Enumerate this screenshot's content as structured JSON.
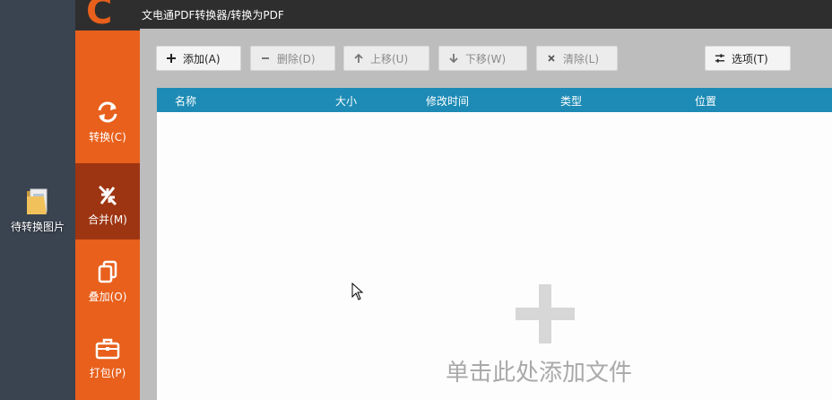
{
  "desktop": {
    "icon": "folder-icon",
    "icon_label": "待转换图片"
  },
  "app": {
    "title": "文电通PDF转换器/转换为PDF",
    "logo_text": "C",
    "brand_color": "#e8601c",
    "accent_color": "#1d8bb5"
  },
  "sidebar": {
    "items": [
      {
        "label": "转换(C)",
        "icon": "refresh-icon",
        "active": false
      },
      {
        "label": "合并(M)",
        "icon": "merge-arrows-icon",
        "active": true
      },
      {
        "label": "叠加(O)",
        "icon": "overlay-pages-icon",
        "active": false
      },
      {
        "label": "打包(P)",
        "icon": "briefcase-icon",
        "active": false
      }
    ]
  },
  "toolbar": {
    "add": {
      "label": "添加(A)",
      "icon": "plus-icon"
    },
    "delete": {
      "label": "删除(D)",
      "icon": "minus-icon"
    },
    "move_up": {
      "label": "上移(U)",
      "icon": "arrow-up-icon"
    },
    "move_down": {
      "label": "下移(W)",
      "icon": "arrow-down-icon"
    },
    "clear": {
      "label": "清除(L)",
      "icon": "x-icon"
    },
    "options": {
      "label": "选项(T)",
      "icon": "sliders-icon"
    }
  },
  "table": {
    "columns": [
      "名称",
      "大小",
      "修改时间",
      "类型",
      "位置"
    ]
  },
  "drop_zone": {
    "text": "单击此处添加文件",
    "icon": "large-plus-icon"
  }
}
